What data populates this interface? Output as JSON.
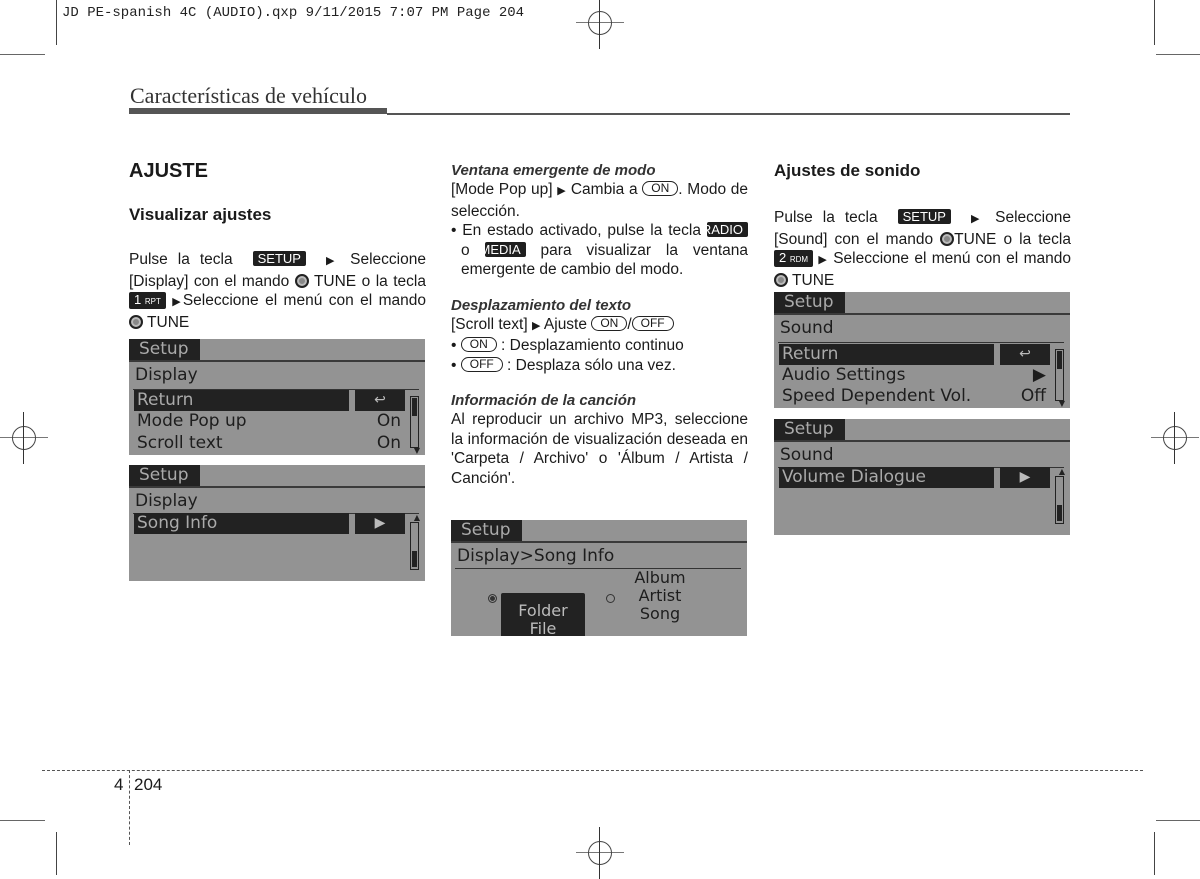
{
  "print_slug": "JD PE-spanish 4C (AUDIO).qxp  9/11/2015  7:07 PM  Page 204",
  "header": {
    "section_title": "Características de vehículo"
  },
  "col1": {
    "title": "AJUSTE",
    "subtitle": "Visualizar ajustes",
    "p1": {
      "a": "Pulse la tecla",
      "key_setup": "SETUP",
      "b": "Seleccione [Display] con el mando",
      "tune": "TUNE",
      "c": "o la tecla",
      "key_1": "1",
      "key_1_sub": "RPT",
      "d": "Seleccione el menú con el mando",
      "e": "TUNE"
    },
    "screen1": {
      "tab": "Setup",
      "crumb": "Display",
      "rows": [
        {
          "label": "Return",
          "value": "↩",
          "selected": true
        },
        {
          "label": "Mode Pop up",
          "value": "On"
        },
        {
          "label": "Scroll text",
          "value": "On"
        }
      ]
    },
    "screen2": {
      "tab": "Setup",
      "crumb": "Display",
      "rows": [
        {
          "label": "Song Info",
          "value": "▶",
          "selected": true
        }
      ]
    }
  },
  "col2": {
    "mode_popup": {
      "heading": "Ventana emergente de modo",
      "line_a": "[Mode Pop up]",
      "line_b": "Cambia a",
      "on": "ON",
      "line_c": ". Modo de selección.",
      "bullet_a": "En estado activado, pulse la tecla",
      "key_radio": "RADIO",
      "or": "o",
      "key_media": "MEDIA",
      "bullet_b": "para visualizar la ventana emergente de cambio del modo."
    },
    "scroll_text": {
      "heading": "Desplazamiento del texto",
      "line_a": "[Scroll text]",
      "line_b": "Ajuste",
      "on": "ON",
      "off": "OFF",
      "bullet_on": ": Desplazamiento continuo",
      "bullet_off": ": Desplaza sólo una vez."
    },
    "song_info": {
      "heading": "Información de la canción",
      "body": "Al reproducir un archivo MP3, seleccione la información de visualización deseada en 'Carpeta / Archivo' o 'Álbum / Artista / Canción'."
    },
    "screen3": {
      "tab": "Setup",
      "crumb": "Display>Song Info",
      "option1": [
        "Folder",
        "File"
      ],
      "option2": [
        "Album",
        "Artist",
        "Song"
      ],
      "selected_option": 1
    }
  },
  "col3": {
    "title": "Ajustes de sonido",
    "p1": {
      "a": "Pulse la tecla",
      "key_setup": "SETUP",
      "b": "Seleccione [Sound] con el mando",
      "tune": "TUNE",
      "c": "o la tecla",
      "key_2": "2",
      "key_2_sub": "RDM",
      "d": "Seleccione el menú con el mando",
      "e": "TUNE"
    },
    "screen4": {
      "tab": "Setup",
      "crumb": "Sound",
      "rows": [
        {
          "label": "Return",
          "value": "↩",
          "selected": true
        },
        {
          "label": "Audio Settings",
          "value": "▶"
        },
        {
          "label": "Speed Dependent Vol.",
          "value": "Off"
        }
      ]
    },
    "screen5": {
      "tab": "Setup",
      "crumb": "Sound",
      "rows": [
        {
          "label": "Volume Dialogue",
          "value": "▶",
          "selected": true
        }
      ]
    }
  },
  "footer": {
    "chapter": "4",
    "page": "204"
  }
}
